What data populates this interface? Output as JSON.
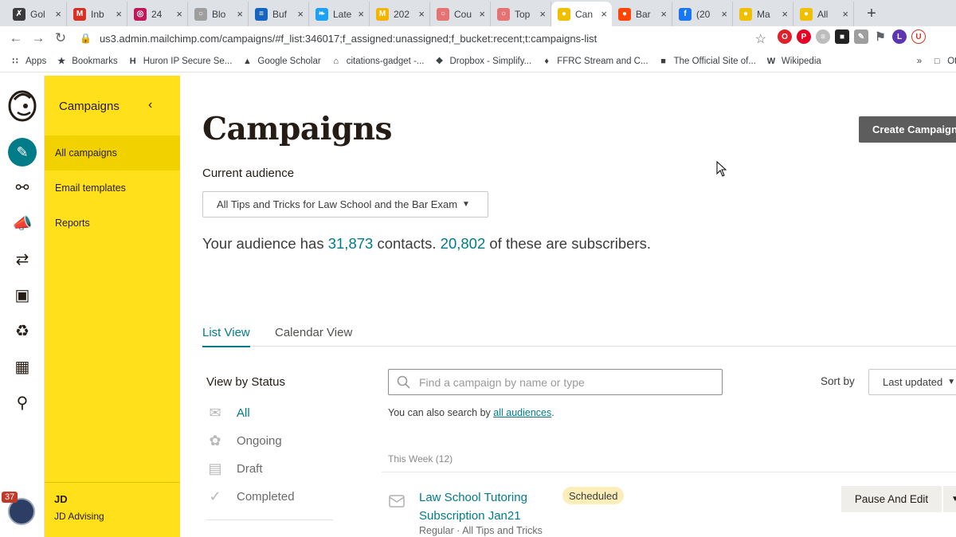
{
  "browser": {
    "tabs": [
      {
        "label": "Gol",
        "fav": "✗",
        "color": "#3b3b3b"
      },
      {
        "label": "Inb",
        "fav": "M",
        "color": "#d93025"
      },
      {
        "label": "24",
        "fav": "◎",
        "color": "#c2185b"
      },
      {
        "label": "Blo",
        "fav": "○",
        "color": "#9e9e9e"
      },
      {
        "label": "Buf",
        "fav": "≡",
        "color": "#1565c0"
      },
      {
        "label": "Late",
        "fav": "❧",
        "color": "#1da1f2"
      },
      {
        "label": "202",
        "fav": "M",
        "color": "#f6b400"
      },
      {
        "label": "Cou",
        "fav": "○",
        "color": "#e57373"
      },
      {
        "label": "Top",
        "fav": "○",
        "color": "#e57373"
      },
      {
        "label": "Can",
        "fav": "●",
        "color": "#f0c000",
        "active": true
      },
      {
        "label": "Bar",
        "fav": "●",
        "color": "#ff4500"
      },
      {
        "label": "(20",
        "fav": "f",
        "color": "#1877f2"
      },
      {
        "label": "Ma",
        "fav": "●",
        "color": "#f0c000"
      },
      {
        "label": "All",
        "fav": "●",
        "color": "#f0c000"
      }
    ],
    "url": "us3.admin.mailchimp.com/campaigns/#f_list:346017;f_assigned:unassigned;f_bucket:recent;t:campaigns-list",
    "bookmarks": [
      {
        "label": "Apps",
        "icon": "∷"
      },
      {
        "label": "Bookmarks",
        "icon": "★"
      },
      {
        "label": "Huron IP Secure Se...",
        "icon": "H"
      },
      {
        "label": "Google Scholar",
        "icon": "▲"
      },
      {
        "label": "citations-gadget -...",
        "icon": "⌂"
      },
      {
        "label": "Dropbox - Simplify...",
        "icon": "❖"
      },
      {
        "label": "FFRC Stream and C...",
        "icon": "♦"
      },
      {
        "label": "The Official Site of...",
        "icon": "■"
      },
      {
        "label": "Wikipedia",
        "icon": "W"
      },
      {
        "label": "»",
        "icon": ""
      },
      {
        "label": "Other b",
        "icon": "□"
      }
    ]
  },
  "sidebar": {
    "section_title": "Campaigns",
    "items": [
      {
        "label": "All campaigns",
        "active": true
      },
      {
        "label": "Email templates"
      },
      {
        "label": "Reports"
      }
    ],
    "org_initials": "JD",
    "org_name": "JD Advising",
    "notification_count": "37"
  },
  "main": {
    "title": "Campaigns",
    "create_button": "Create Campaign",
    "audience_label": "Current audience",
    "audience_selected": "All Tips and Tricks for Law School and the Bar Exam",
    "summary_prefix": "Your audience has ",
    "contacts": "31,873",
    "summary_middle": " contacts. ",
    "subscribers": "20,802",
    "summary_suffix": " of these are subscribers.",
    "view_tabs": [
      "List View",
      "Calendar View"
    ],
    "status_title": "View by Status",
    "statuses": [
      "All",
      "Ongoing",
      "Draft",
      "Completed"
    ],
    "search_placeholder": "Find a campaign by name or type",
    "search_hint_prefix": "You can also search by ",
    "search_hint_link": "all audiences",
    "search_hint_suffix": ".",
    "sort_label": "Sort by",
    "sort_value": "Last updated",
    "group_label": "This Week (12)",
    "campaign": {
      "name": "Law School Tutoring Subscription Jan21",
      "meta": "Regular · All Tips and Tricks",
      "badge": "Scheduled",
      "action": "Pause And Edit"
    }
  }
}
